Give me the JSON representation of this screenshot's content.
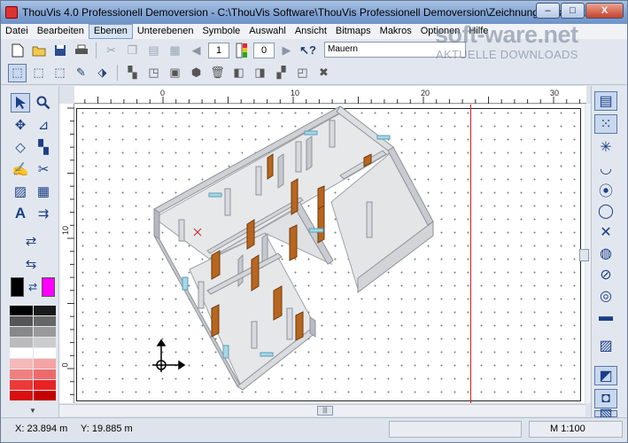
{
  "window": {
    "title": "ThouVis 4.0 Professionell Demoversion - C:\\ThouVis Software\\ThouVis Professionell Demoversion\\Zeichnungen\\Isometrie.tvz",
    "minimize": "–",
    "maximize": "□",
    "close": "X"
  },
  "menu": [
    "Datei",
    "Bearbeiten",
    "Ebenen",
    "Unterebenen",
    "Symbole",
    "Auswahl",
    "Ansicht",
    "Bitmaps",
    "Makros",
    "Optionen",
    "Hilfe"
  ],
  "toolbar1": {
    "layer_number": "1",
    "sublayer_number": "0",
    "layer_name": "Mauern"
  },
  "watermark": {
    "brand": "soft-ware.net",
    "tagline": "AKTUELLE DOWNLOADS"
  },
  "ruler": {
    "horizontal": [
      "0",
      "10",
      "20",
      "30"
    ],
    "vertical": [
      "10",
      "0"
    ]
  },
  "status": {
    "x": "X: 23.894 m",
    "y": "Y: 19.885 m",
    "scale": "M 1:100"
  },
  "colors": {
    "wall": "#d4d6da",
    "wall_dark": "#a9acb2",
    "door": "#b8661e",
    "accent_red": "#d02020",
    "swap_left": "#000000",
    "swap_right": "#ff00ff"
  },
  "icons": {
    "arrow_select": "arrow-select-icon",
    "zoom": "magnifier-icon"
  }
}
